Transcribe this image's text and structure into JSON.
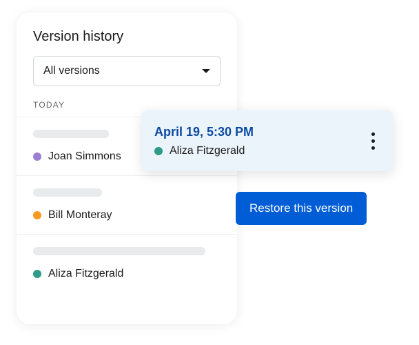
{
  "panel": {
    "title": "Version history",
    "filter": {
      "selected": "All versions"
    },
    "sectionLabel": "TODAY",
    "items": [
      {
        "author": "Joan Simmons",
        "color": "#9b7fd4",
        "skeletonWidth": 110
      },
      {
        "author": "Bill Monteray",
        "color": "#f79a1f",
        "skeletonWidth": 100
      },
      {
        "author": "Aliza Fitzgerald",
        "color": "#2f9a87",
        "skeletonWidth": 250
      }
    ]
  },
  "popover": {
    "timestamp": "April 19, 5:30 PM",
    "author": "Aliza Fitzgerald",
    "authorColor": "#2f9a87"
  },
  "actions": {
    "restore": "Restore this version"
  }
}
